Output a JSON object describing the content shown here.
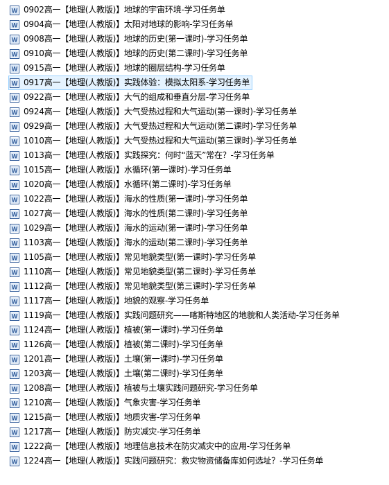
{
  "files": [
    {
      "name": "0902高一【地理(人教版)】地球的宇宙环境-学习任务单",
      "icon": "word-document-icon"
    },
    {
      "name": "0904高一【地理(人教版)】太阳对地球的影响-学习任务单",
      "icon": "word-document-icon"
    },
    {
      "name": "0908高一【地理(人教版)】地球的历史(第一课时)-学习任务单",
      "icon": "word-document-icon"
    },
    {
      "name": "0910高一【地理(人教版)】地球的历史(第二课时)-学习任务单",
      "icon": "word-document-icon"
    },
    {
      "name": "0915高一【地理(人教版)】地球的圈层结构-学习任务单",
      "icon": "word-document-icon"
    },
    {
      "name": "0917高一【地理(人教版)】实践体验：模拟太阳系-学习任务单",
      "icon": "word-document-icon",
      "selected": true
    },
    {
      "name": "0922高一【地理(人教版)】大气的组成和垂直分层-学习任务单",
      "icon": "word-document-icon"
    },
    {
      "name": "0924高一【地理(人教版)】大气受热过程和大气运动(第一课时)-学习任务单",
      "icon": "word-document-icon"
    },
    {
      "name": "0929高一【地理(人教版)】大气受热过程和大气运动(第二课时)-学习任务单",
      "icon": "word-document-icon"
    },
    {
      "name": "1010高一【地理(人教版)】大气受热过程和大气运动(第三课时)-学习任务单",
      "icon": "word-document-icon"
    },
    {
      "name": "1013高一【地理(人教版)】实践探究：何时“蓝天”常在？-学习任务单",
      "icon": "word-document-icon"
    },
    {
      "name": "1015高一【地理(人教版)】水循环(第一课时)-学习任务单",
      "icon": "word-document-icon"
    },
    {
      "name": "1020高一【地理(人教版)】水循环(第二课时)-学习任务单",
      "icon": "word-document-icon"
    },
    {
      "name": "1022高一【地理(人教版)】海水的性质(第一课时)-学习任务单",
      "icon": "word-document-icon"
    },
    {
      "name": "1027高一【地理(人教版)】海水的性质(第二课时)-学习任务单",
      "icon": "word-document-icon"
    },
    {
      "name": "1029高一【地理(人教版)】海水的运动(第一课时)-学习任务单",
      "icon": "word-document-icon"
    },
    {
      "name": "1103高一【地理(人教版)】海水的运动(第二课时)-学习任务单",
      "icon": "word-document-icon"
    },
    {
      "name": "1105高一【地理(人教版)】常见地貌类型(第一课时)-学习任务单",
      "icon": "word-document-icon"
    },
    {
      "name": "1110高一【地理(人教版)】常见地貌类型(第二课时)-学习任务单",
      "icon": "word-document-icon"
    },
    {
      "name": "1112高一【地理(人教版)】常见地貌类型(第三课时)-学习任务单",
      "icon": "word-document-icon"
    },
    {
      "name": "1117高一【地理(人教版)】地貌的观察-学习任务单",
      "icon": "word-document-icon"
    },
    {
      "name": "1119高一【地理(人教版)】实践问题研究——喀斯特地区的地貌和人类活动-学习任务单",
      "icon": "word-document-icon"
    },
    {
      "name": "1124高一【地理(人教版)】植被(第一课时)-学习任务单",
      "icon": "word-document-icon"
    },
    {
      "name": "1126高一【地理(人教版)】植被(第二课时)-学习任务单",
      "icon": "word-document-icon"
    },
    {
      "name": "1201高一【地理(人教版)】土壤(第一课时)-学习任务单",
      "icon": "word-document-icon"
    },
    {
      "name": "1203高一【地理(人教版)】土壤(第二课时)-学习任务单",
      "icon": "word-document-icon"
    },
    {
      "name": "1208高一【地理(人教版)】植被与土壤实践问题研究-学习任务单",
      "icon": "word-document-icon"
    },
    {
      "name": "1210高一【地理(人教版)】气象灾害-学习任务单",
      "icon": "word-document-icon"
    },
    {
      "name": "1215高一【地理(人教版)】地质灾害-学习任务单",
      "icon": "word-document-icon"
    },
    {
      "name": "1217高一【地理(人教版)】防灾减灾-学习任务单",
      "icon": "word-document-icon"
    },
    {
      "name": "1222高一【地理(人教版)】地理信息技术在防灾减灾中的应用-学习任务单",
      "icon": "word-document-icon"
    },
    {
      "name": "1224高一【地理(人教版)】实践问题研究：救灾物资储备库如何选址？-学习任务单",
      "icon": "word-document-icon"
    }
  ],
  "colors": {
    "selection_bg": "#e5f3ff",
    "selection_border": "#99d1ff",
    "word_blue": "#2b5797"
  }
}
